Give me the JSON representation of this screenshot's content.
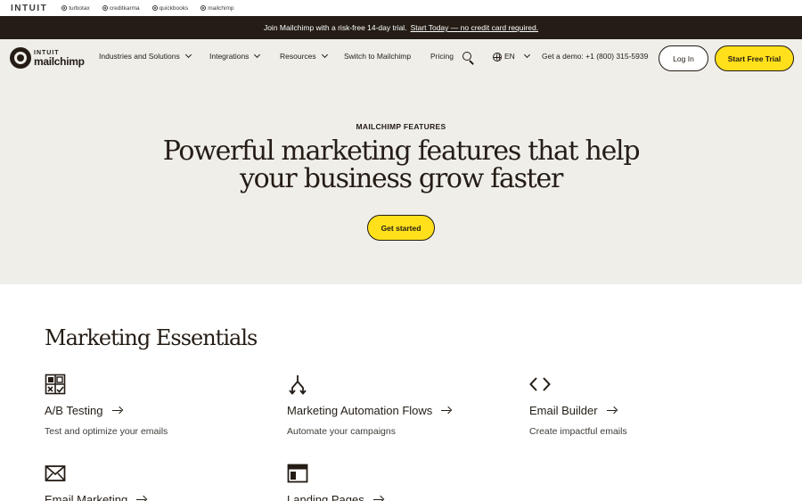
{
  "brand_bar": {
    "parent": "INTUIT",
    "siblings": [
      "turbotax",
      "creditkarma",
      "quickbooks",
      "mailchimp"
    ]
  },
  "promo": {
    "text": "Join Mailchimp with a risk-free 14-day trial.",
    "link": "Start Today — no credit card required."
  },
  "nav": {
    "logo_top": "INTUIT",
    "logo_bottom": "mailchimp",
    "items": [
      {
        "label": "Industries and Solutions",
        "dropdown": true
      },
      {
        "label": "Integrations",
        "dropdown": true
      },
      {
        "label": "Resources",
        "dropdown": true
      },
      {
        "label": "Switch to Mailchimp",
        "dropdown": false
      },
      {
        "label": "Pricing",
        "dropdown": false
      }
    ],
    "language": "EN",
    "demo": "Get a demo: +1 (800) 315-5939",
    "login": "Log In",
    "trial": "Start Free Trial"
  },
  "hero": {
    "eyebrow": "MAILCHIMP FEATURES",
    "headline_line1": "Powerful marketing features that help",
    "headline_line2": "your business grow faster",
    "cta": "Get started"
  },
  "essentials": {
    "title": "Marketing Essentials",
    "features": [
      {
        "icon": "ab-test-icon",
        "title": "A/B Testing",
        "desc": "Test and optimize your emails"
      },
      {
        "icon": "automation-flow-icon",
        "title": "Marketing Automation Flows",
        "desc": "Automate your campaigns"
      },
      {
        "icon": "code-icon",
        "title": "Email Builder",
        "desc": "Create impactful emails"
      },
      {
        "icon": "envelope-icon",
        "title": "Email Marketing",
        "desc": ""
      },
      {
        "icon": "landing-page-icon",
        "title": "Landing Pages",
        "desc": ""
      }
    ]
  },
  "colors": {
    "accent_yellow": "#ffe01b",
    "dark": "#241c15",
    "hero_bg": "#efeee9"
  }
}
